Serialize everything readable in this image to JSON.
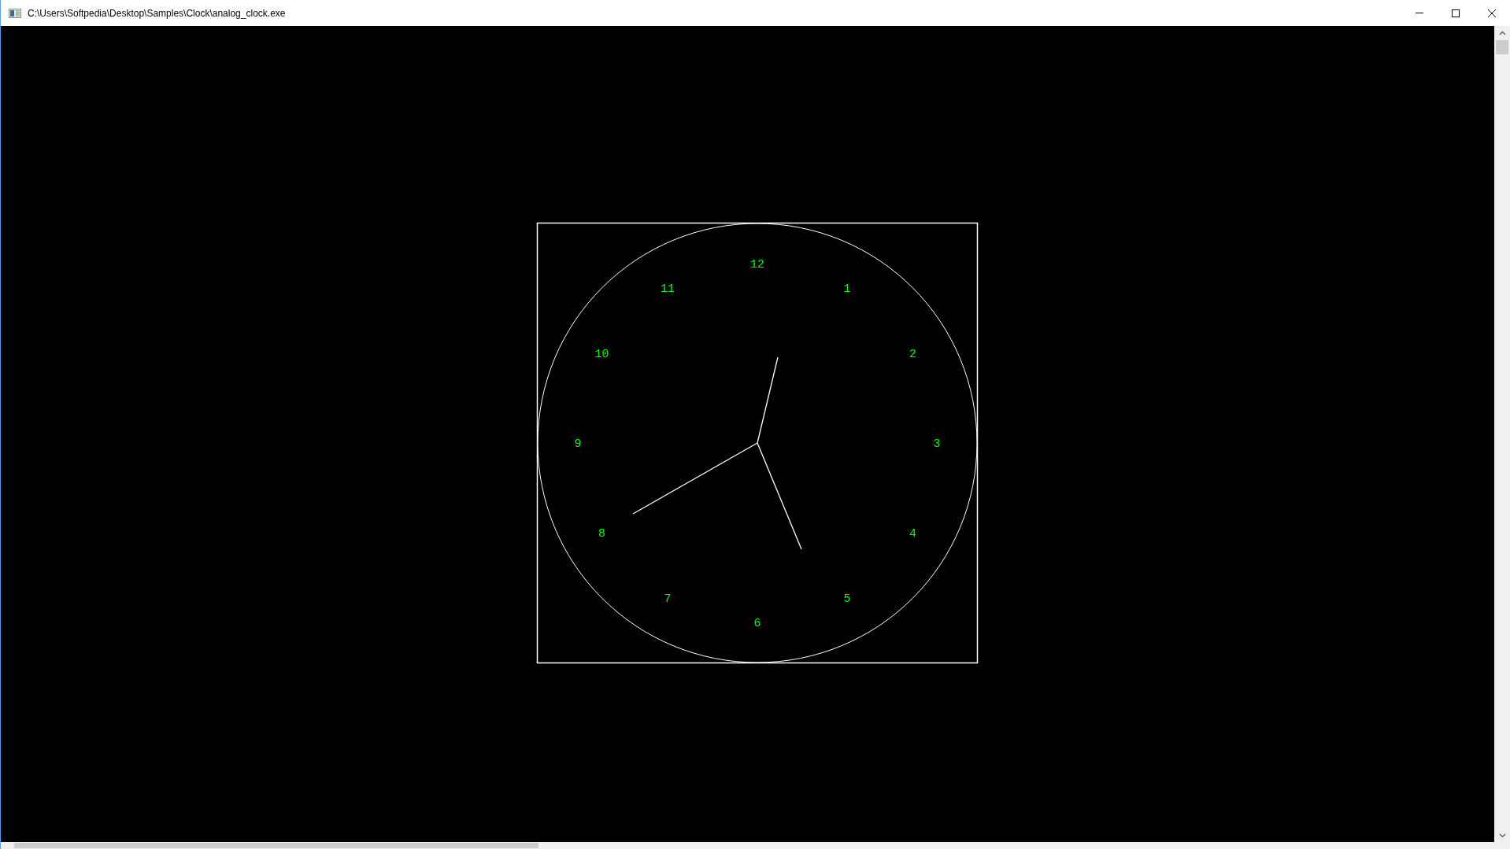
{
  "window": {
    "title": "C:\\Users\\Softpedia\\Desktop\\Samples\\Clock\\analog_clock.exe"
  },
  "clock": {
    "numerals": [
      "12",
      "1",
      "2",
      "3",
      "4",
      "5",
      "6",
      "7",
      "8",
      "9",
      "10",
      "11"
    ]
  }
}
